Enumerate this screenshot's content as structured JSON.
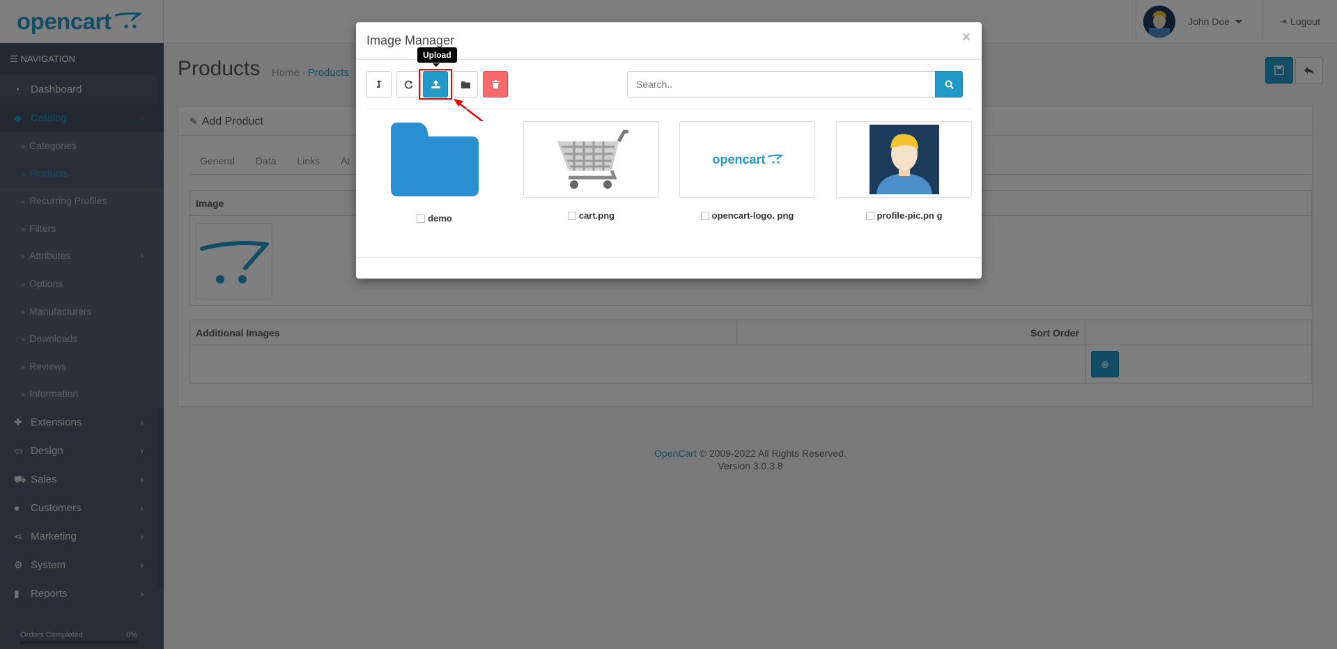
{
  "header": {
    "logo_text": "opencart",
    "user_name": "John Doe",
    "logout_label": "Logout"
  },
  "sidebar": {
    "heading": "NAVIGATION",
    "items": [
      {
        "label": "Dashboard",
        "icon": "dashboard-icon"
      },
      {
        "label": "Catalog",
        "icon": "tags-icon",
        "active": true
      }
    ],
    "catalog_sub": [
      {
        "label": "Categories"
      },
      {
        "label": "Products",
        "active": true
      },
      {
        "label": "Recurring Profiles"
      },
      {
        "label": "Filters"
      },
      {
        "label": "Attributes"
      },
      {
        "label": "Options"
      },
      {
        "label": "Manufacturers"
      },
      {
        "label": "Downloads"
      },
      {
        "label": "Reviews"
      },
      {
        "label": "Information"
      }
    ],
    "lower_items": [
      {
        "label": "Extensions",
        "icon": "puzzle-icon"
      },
      {
        "label": "Design",
        "icon": "monitor-icon"
      },
      {
        "label": "Sales",
        "icon": "cart-icon"
      },
      {
        "label": "Customers",
        "icon": "user-icon"
      },
      {
        "label": "Marketing",
        "icon": "share-icon"
      },
      {
        "label": "System",
        "icon": "cog-icon"
      },
      {
        "label": "Reports",
        "icon": "bar-chart-icon"
      }
    ],
    "progress": {
      "label": "Orders Completed",
      "value_text": "0%",
      "value": 0
    }
  },
  "page": {
    "title": "Products",
    "breadcrumb": [
      "Home",
      "Products"
    ],
    "panel_title": "Add Product",
    "tabs": [
      "General",
      "Data",
      "Links",
      "At"
    ],
    "image_header": "Image",
    "additional_images_header": "Additional Images",
    "sort_order_header": "Sort Order"
  },
  "footer": {
    "brand": "OpenCart",
    "copyright": "© 2009-2022 All Rights Reserved.",
    "version": "Version 3.0.3.8"
  },
  "modal": {
    "title": "Image Manager",
    "close": "×",
    "tooltip": "Upload",
    "search_placeholder": "Search..",
    "files": [
      {
        "name": "demo",
        "type": "folder"
      },
      {
        "name": "cart.png",
        "type": "image"
      },
      {
        "name": "opencart-logo. png",
        "type": "image"
      },
      {
        "name": "profile-pic.pn g",
        "type": "image"
      }
    ],
    "thumb_logo_text": "opencart"
  },
  "colors": {
    "accent": "#229ac8",
    "danger": "#f56b6b",
    "sidebar": "#515a6e",
    "highlight": "#ee0000"
  }
}
